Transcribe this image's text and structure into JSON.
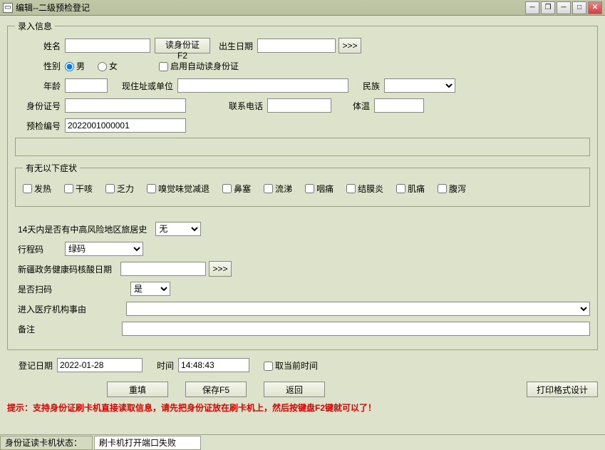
{
  "title": "编辑--二级预检登记",
  "group_input": "录入信息",
  "labels": {
    "name": "姓名",
    "read_id": "读身份证F2",
    "birth": "出生日期",
    "arrow": ">>>",
    "gender": "性别",
    "male": "男",
    "female": "女",
    "auto_read": "启用自动读身份证",
    "age": "年龄",
    "address": "现住址或单位",
    "nation": "民族",
    "id_no": "身份证号",
    "phone": "联系电话",
    "temp": "体温",
    "precheck_no": "预检编号"
  },
  "precheck_value": "2022001000001",
  "group_symptoms": "有无以下症状",
  "symptoms": [
    "发热",
    "干咳",
    "乏力",
    "嗅觉味觉减退",
    "鼻塞",
    "流涕",
    "咽痛",
    "结膜炎",
    "肌痛",
    "腹泻"
  ],
  "travel14": "14天内是否有中高风险地区旅居史",
  "travel14_val": "无",
  "trip_code": "行程码",
  "trip_code_val": "绿码",
  "nucleic_date": "新疆政务健康码核酸日期",
  "is_scan": "是否扫码",
  "is_scan_val": "是",
  "enter_reason": "进入医疗机构事由",
  "remark": "备注",
  "reg_date_lbl": "登记日期",
  "reg_date_val": "2022-01-28",
  "time_lbl": "时间",
  "time_val": "14:48:43",
  "use_current": "取当前时间",
  "btn_reset": "重填",
  "btn_save": "保存F5",
  "btn_back": "返回",
  "btn_print": "打印格式设计",
  "tip": "提示：支持身份证刷卡机直接读取信息，请先把身份证放在刷卡机上，然后按键盘F2键就可以了！",
  "status_lbl": "身份证读卡机状态：",
  "status_val": "刷卡机打开端口失败"
}
